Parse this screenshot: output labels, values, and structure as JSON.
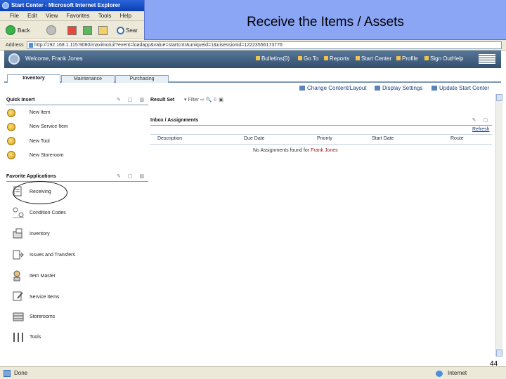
{
  "slide": {
    "title": "Receive the Items / Assets",
    "page_number": "44"
  },
  "browser": {
    "window_title": "Start Center - Microsoft Internet Explorer",
    "menu": [
      "File",
      "Edit",
      "View",
      "Favorites",
      "Tools",
      "Help"
    ],
    "toolbar": {
      "back_label": "Back",
      "search_label": "Sear"
    },
    "address_label": "Address",
    "address_value": "http://192.168.1.115:9080/maximo/ui/?event=loadapp&value=startcntr&uniqueid=1&uisessionid=12223556173776",
    "status_text": "Done",
    "zone_text": "Internet"
  },
  "header": {
    "welcome": "Welcome, Frank Jones",
    "links": [
      "Bulletins(0)",
      "Go To",
      "Reports",
      "Start Center",
      "Profile",
      "Sign Out",
      "Help"
    ]
  },
  "tabs": [
    "Inventory",
    "Maintenance",
    "Purchasing"
  ],
  "actions": [
    "Change Content/Layout",
    "Display Settings",
    "Update Start Center"
  ],
  "quick_insert": {
    "title": "Quick Insert",
    "items": [
      "New Item",
      "New Service Item",
      "New Tool",
      "New Storeroom"
    ]
  },
  "favorite_apps": {
    "title": "Favorite Applications",
    "items": [
      "Receiving",
      "Condition Codes",
      "Inventory",
      "Issues and Transfers",
      "Item Master",
      "Service Items",
      "Storerooms",
      "Tools"
    ]
  },
  "result_set": {
    "title": "Result Set",
    "filter_label": "Filter"
  },
  "inbox": {
    "title": "Inbox / Assignments",
    "refresh": "Refresh",
    "columns": [
      "Description",
      "Due Date",
      "Priority",
      "Start Date",
      "Route"
    ],
    "empty_message": "No Assignments found for",
    "empty_user": "Frank Jones"
  },
  "colors": {
    "header_bg": "#3f5d80",
    "title_panel": "#8ca6f6",
    "portlet_rule": "#7c97b7",
    "user_red": "#a01818"
  }
}
